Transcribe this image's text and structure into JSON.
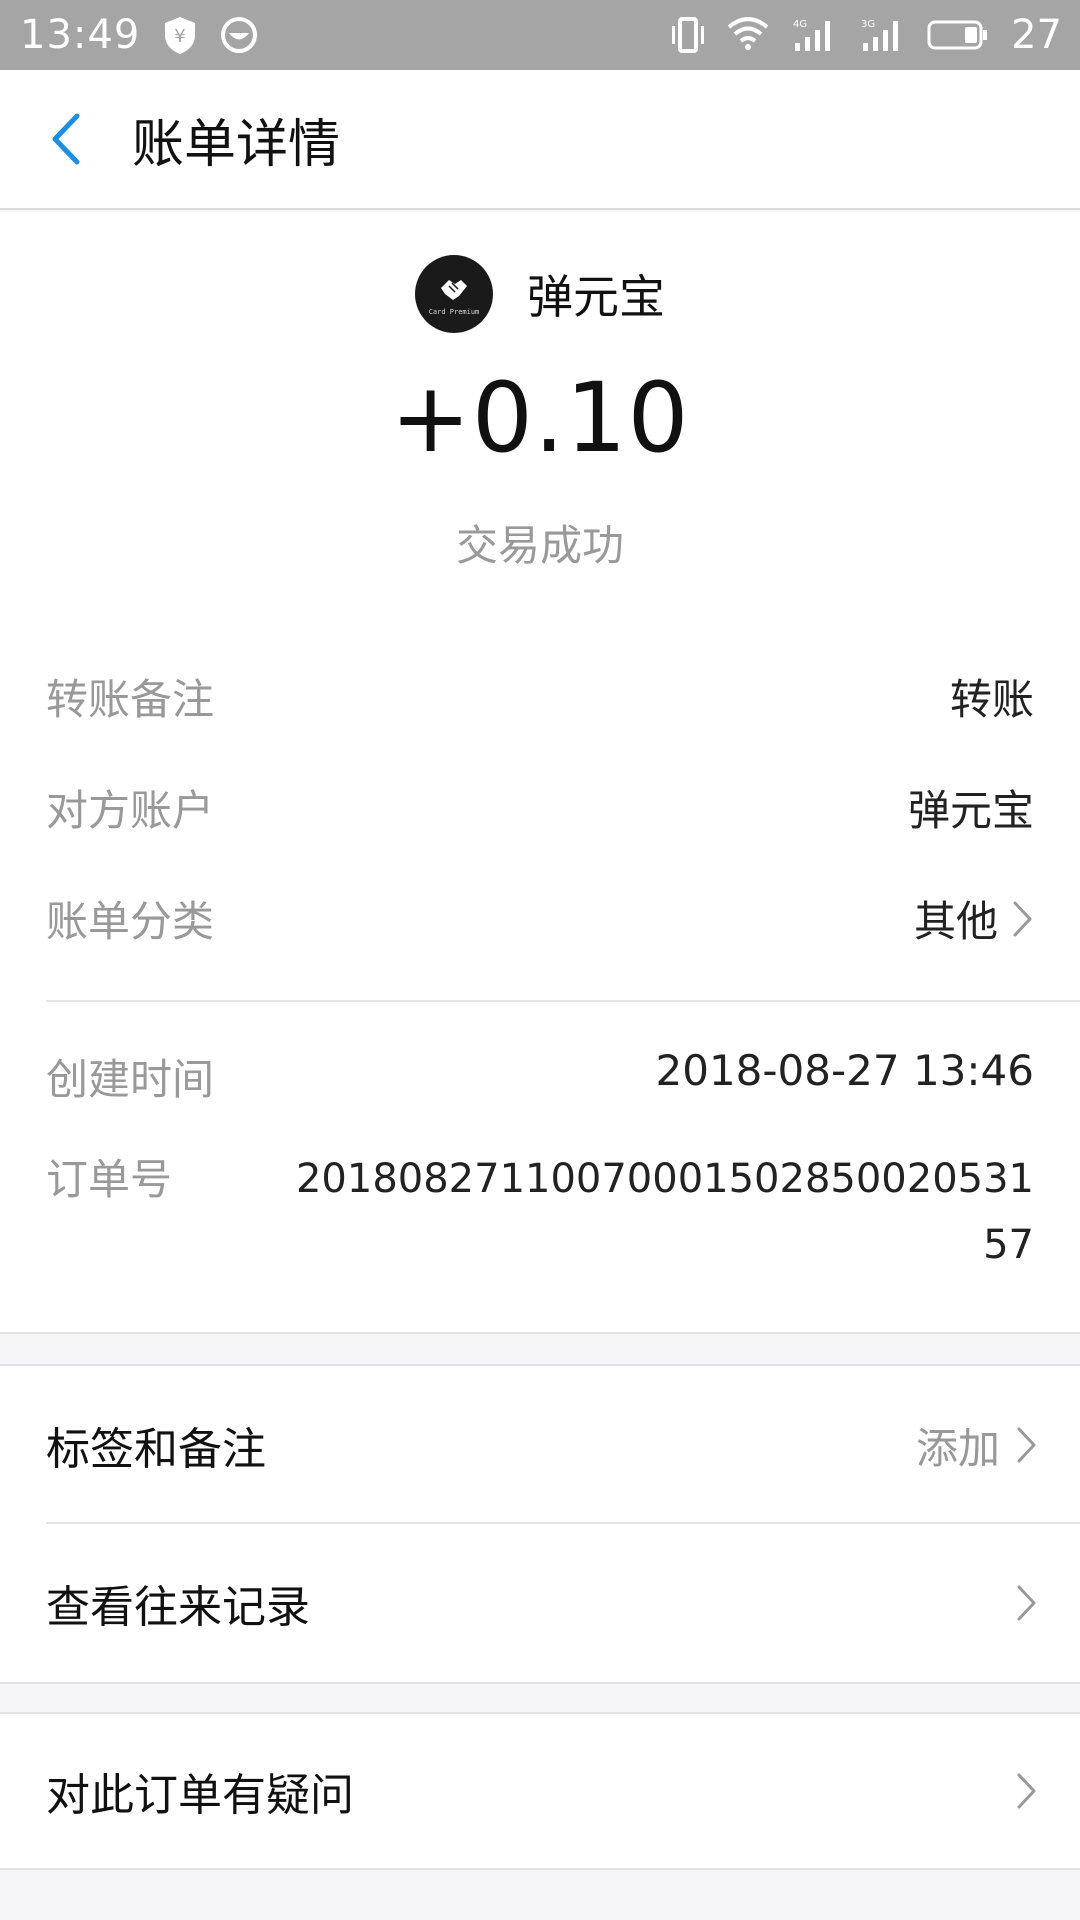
{
  "status_bar": {
    "time": "13:49",
    "battery": "27"
  },
  "nav": {
    "title": "账单详情"
  },
  "merchant": {
    "name": "弹元宝",
    "avatar_text": "Card Premium"
  },
  "amount": "+0.10",
  "status": "交易成功",
  "details": [
    {
      "label": "转账备注",
      "value": "转账"
    },
    {
      "label": "对方账户",
      "value": "弹元宝"
    },
    {
      "label": "账单分类",
      "value": "其他"
    },
    {
      "label": "创建时间",
      "value": "2018-08-27 13:46"
    },
    {
      "label": "订单号",
      "value": "2018082711007000150285002053157"
    }
  ],
  "group1": [
    {
      "label": "标签和备注",
      "hint": "添加"
    },
    {
      "label": "查看往来记录",
      "hint": ""
    }
  ],
  "group2": [
    {
      "label": "对此订单有疑问"
    }
  ],
  "colors": {
    "accent": "#1a8fe3",
    "status_bar": "#a5a5a5",
    "muted": "#999999"
  }
}
